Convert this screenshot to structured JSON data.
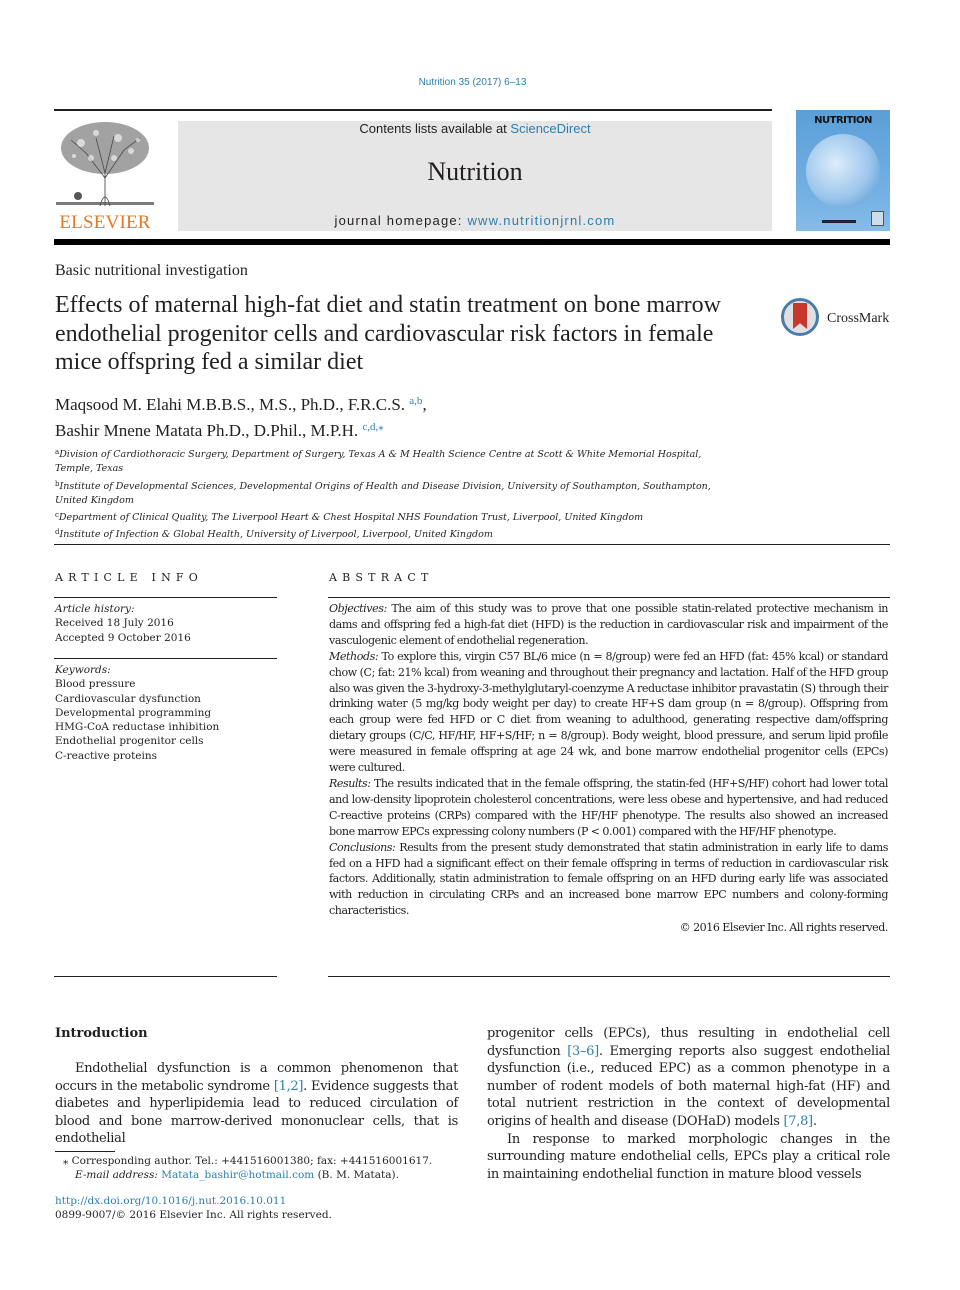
{
  "header": {
    "citation": "Nutrition 35 (2017) 6–13",
    "publisher_logo": "ELSEVIER",
    "contents_prefix": "Contents lists available at ",
    "contents_link": "ScienceDirect",
    "journal_name": "Nutrition",
    "homepage_prefix": "journal homepage: ",
    "homepage_link": "www.nutritionjrnl.com",
    "cover_title": "NUTRITION"
  },
  "article": {
    "section_type": "Basic nutritional investigation",
    "title": "Effects of maternal high-fat diet and statin treatment on bone marrow endothelial progenitor cells and cardiovascular risk factors in female mice offspring fed a similar diet",
    "crossmark_label": "CrossMark",
    "authors": [
      {
        "name": "Maqsood M. Elahi M.B.B.S., M.S., Ph.D., F.R.C.S.",
        "affil": "a,b",
        "sep": ","
      },
      {
        "name": "Bashir Mnene Matata Ph.D., D.Phil., M.P.H.",
        "affil": "c,d,⁎",
        "sep": ""
      }
    ],
    "affiliations": [
      {
        "key": "a",
        "text": "Division of Cardiothoracic Surgery, Department of Surgery, Texas A & M Health Science Centre at Scott & White Memorial Hospital, Temple, Texas"
      },
      {
        "key": "b",
        "text": "Institute of Developmental Sciences, Developmental Origins of Health and Disease Division, University of Southampton, Southampton, United Kingdom"
      },
      {
        "key": "c",
        "text": "Department of Clinical Quality, The Liverpool Heart & Chest Hospital NHS Foundation Trust, Liverpool, United Kingdom"
      },
      {
        "key": "d",
        "text": "Institute of Infection & Global Health, University of Liverpool, Liverpool, United Kingdom"
      }
    ]
  },
  "article_info": {
    "heading": "ARTICLE INFO",
    "history_label": "Article history:",
    "received": "Received 18 July 2016",
    "accepted": "Accepted 9 October 2016",
    "keywords_label": "Keywords:",
    "keywords": [
      "Blood pressure",
      "Cardiovascular dysfunction",
      "Developmental programming",
      "HMG-CoA reductase inhibition",
      "Endothelial progenitor cells",
      "C-reactive proteins"
    ]
  },
  "abstract": {
    "heading": "ABSTRACT",
    "sections": [
      {
        "label": "Objectives:",
        "text": " The aim of this study was to prove that one possible statin-related protective mechanism in dams and offspring fed a high-fat diet (HFD) is the reduction in cardiovascular risk and impairment of the vasculogenic element of endothelial regeneration."
      },
      {
        "label": "Methods:",
        "text": " To explore this, virgin C57 BL/6 mice (n = 8/group) were fed an HFD (fat: 45% kcal) or standard chow (C; fat: 21% kcal) from weaning and throughout their pregnancy and lactation. Half of the HFD group also was given the 3-hydroxy-3-methylglutaryl-coenzyme A reductase inhibitor pravastatin (S) through their drinking water (5 mg/kg body weight per day) to create HF+S dam group (n = 8/group). Offspring from each group were fed HFD or C diet from weaning to adulthood, generating respective dam/offspring dietary groups (C/C, HF/HF, HF+S/HF; n = 8/group). Body weight, blood pressure, and serum lipid profile were measured in female offspring at age 24 wk, and bone marrow endothelial progenitor cells (EPCs) were cultured."
      },
      {
        "label": "Results:",
        "text": " The results indicated that in the female offspring, the statin-fed (HF+S/HF) cohort had lower total and low-density lipoprotein cholesterol concentrations, were less obese and hypertensive, and had reduced C-reactive proteins (CRPs) compared with the HF/HF phenotype. The results also showed an increased bone marrow EPCs expressing colony numbers (P < 0.001) compared with the HF/HF phenotype."
      },
      {
        "label": "Conclusions:",
        "text": " Results from the present study demonstrated that statin administration in early life to dams fed on a HFD had a significant effect on their female offspring in terms of reduction in cardiovascular risk factors. Additionally, statin administration to female offspring on an HFD during early life was associated with reduction in circulating CRPs and an increased bone marrow EPC numbers and colony-forming characteristics."
      }
    ],
    "copyright": "© 2016 Elsevier Inc. All rights reserved."
  },
  "introduction": {
    "heading": "Introduction",
    "col1_p1_a": "Endothelial dysfunction is a common phenomenon that occurs in the metabolic syndrome ",
    "col1_p1_ref": "[1,2]",
    "col1_p1_b": ". Evidence suggests that diabetes and hyperlipidemia lead to reduced circulation of blood and bone marrow-derived mononuclear cells, that is endothelial",
    "col2_p1_a": "progenitor cells (EPCs), thus resulting in endothelial cell dysfunction ",
    "col2_p1_ref1": "[3–6]",
    "col2_p1_b": ". Emerging reports also suggest endothelial dysfunction (i.e., reduced EPC) as a common phenotype in a number of rodent models of both maternal high-fat (HF) and total nutrient restriction in the context of developmental origins of health and disease (DOHaD) models ",
    "col2_p1_ref2": "[7,8]",
    "col2_p1_c": ".",
    "col2_p2": "In response to marked morphologic changes in the surrounding mature endothelial cells, EPCs play a critical role in maintaining endothelial function in mature blood vessels"
  },
  "footnotes": {
    "corresponding": "⁎  Corresponding author. Tel.: +441516001380; fax: +441516001617.",
    "email_label": "E-mail address: ",
    "email": "Matata_bashir@hotmail.com",
    "email_suffix": " (B. M. Matata).",
    "doi": "http://dx.doi.org/10.1016/j.nut.2016.10.011",
    "issn": "0899-9007/© 2016 Elsevier Inc. All rights reserved."
  }
}
